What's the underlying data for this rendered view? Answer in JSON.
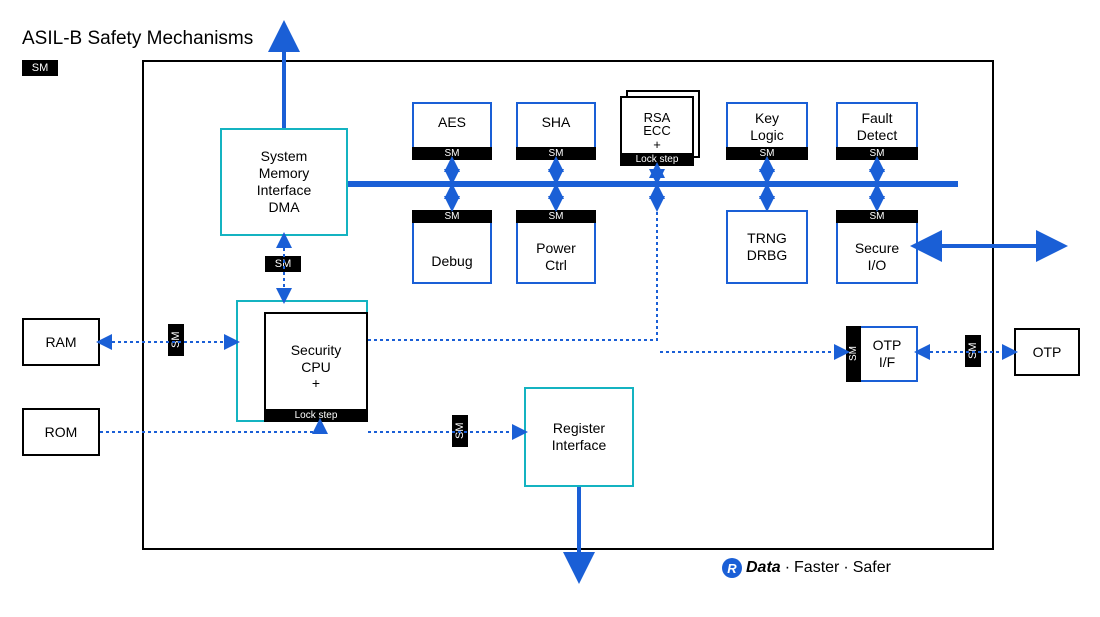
{
  "title": "ASIL-B Safety Mechanisms",
  "sm_label": "SM",
  "lockstep_label": "Lock step",
  "blocks": {
    "sys_mem": "System\nMemory\nInterface\nDMA",
    "aes": "AES",
    "sha": "SHA",
    "rsa_ecc": "RSA\nECC\n+",
    "key_logic": "Key\nLogic",
    "fault_detect": "Fault\nDetect",
    "debug": "Debug",
    "power_ctrl": "Power\nCtrl",
    "trng": "TRNG\nDRBG",
    "secure_io": "Secure\nI/O",
    "security_cpu": "Security\nCPU\n+",
    "reg_if": "Register\nInterface",
    "otp_if": "OTP\nI/F",
    "ram": "RAM",
    "rom": "ROM",
    "otp": "OTP"
  },
  "tagline": {
    "brand_letter": "R",
    "data": "Data",
    "faster": "Faster",
    "safer": "Safer",
    "dot": "·"
  }
}
